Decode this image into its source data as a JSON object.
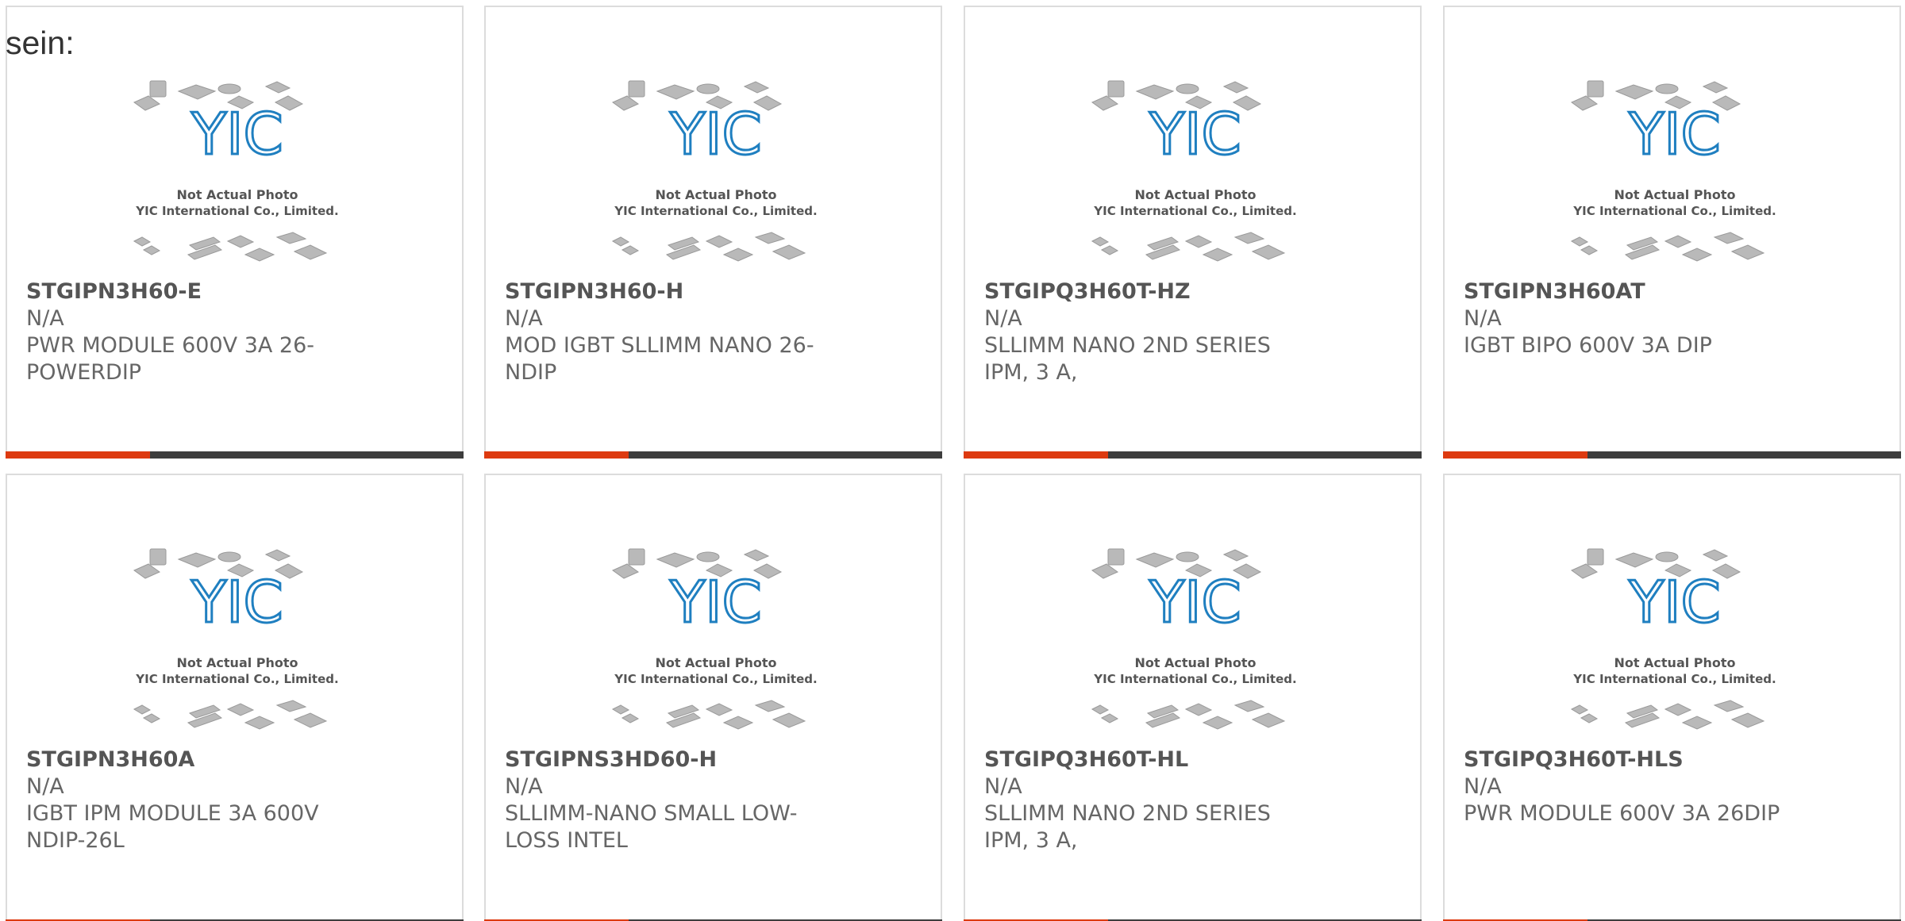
{
  "lead_text": "sein:",
  "thumbnail": {
    "line1": "Not Actual Photo",
    "line2": "YIC International Co., Limited.",
    "logo_text": "YIC",
    "logo_color": "#1f7fc0"
  },
  "colors": {
    "accent": "#dd3a10",
    "bar": "#3d3d3d",
    "border": "#dcdcdc"
  },
  "products": [
    {
      "part_number": "STGIPN3H60-E",
      "manufacturer": "N/A",
      "description": "PWR MODULE 600V 3A 26-POWERDIP"
    },
    {
      "part_number": "STGIPN3H60-H",
      "manufacturer": "N/A",
      "description": "MOD IGBT SLLIMM NANO 26-NDIP"
    },
    {
      "part_number": "STGIPQ3H60T-HZ",
      "manufacturer": "N/A",
      "description": "SLLIMM NANO 2ND SERIES IPM, 3 A,"
    },
    {
      "part_number": "STGIPN3H60AT",
      "manufacturer": "N/A",
      "description": "IGBT BIPO 600V 3A DIP"
    },
    {
      "part_number": "STGIPN3H60A",
      "manufacturer": "N/A",
      "description": "IGBT IPM MODULE 3A 600V NDIP-26L"
    },
    {
      "part_number": "STGIPNS3HD60-H",
      "manufacturer": "N/A",
      "description": "SLLIMM-NANO SMALL LOW-LOSS INTEL"
    },
    {
      "part_number": "STGIPQ3H60T-HL",
      "manufacturer": "N/A",
      "description": "SLLIMM NANO 2ND SERIES IPM, 3 A,"
    },
    {
      "part_number": "STGIPQ3H60T-HLS",
      "manufacturer": "N/A",
      "description": "PWR MODULE 600V 3A 26DIP"
    }
  ]
}
